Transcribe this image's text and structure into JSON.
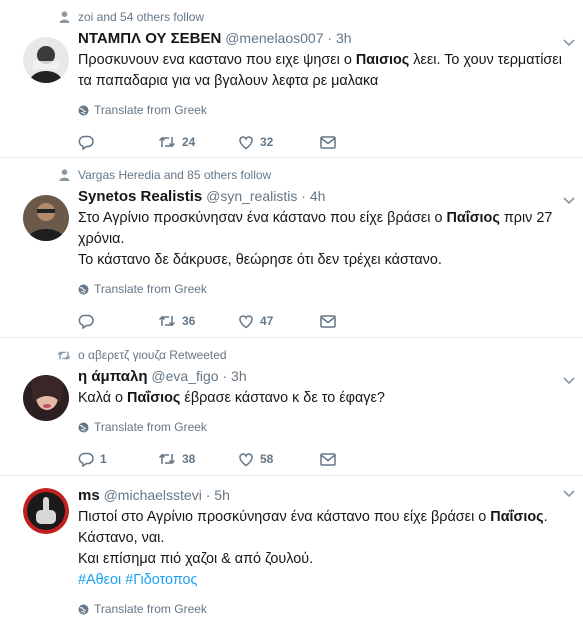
{
  "tweets": [
    {
      "context": "zoi and 54 others follow",
      "context_icon": "person-icon",
      "name": "ΝΤΑΜΠΛ ΟΥ ΣΕΒΕΝ",
      "handle": "@menelaos007",
      "dot": "·",
      "time": "3h",
      "text_parts": [
        "Προσκυνουν ενα καστανο που ειχε ψησει ο ",
        "Παισιος",
        " λεει. Το χουν τερματίσει τα παπαδαρια για να βγαλουν λεφτα ρε μαλακα"
      ],
      "translate": "Translate from Greek",
      "replies": "",
      "retweets": "24",
      "likes": "32"
    },
    {
      "context": "Vargas Heredia and 85 others follow",
      "context_icon": "person-icon",
      "name": "Synetos Realistis",
      "handle": "@syn_realistis",
      "dot": "·",
      "time": "4h",
      "text_parts": [
        "Στο Αγρίνιο προσκύνησαν ένα κάστανο που είχε βράσει ο ",
        "Παΐσιος",
        " πριν 27 χρόνια."
      ],
      "text_line2": "Το κάστανο δε δάκρυσε, θεώρησε ότι δεν τρέχει κάστανο.",
      "translate": "Translate from Greek",
      "replies": "",
      "retweets": "36",
      "likes": "47"
    },
    {
      "context": "ο αβερετζ γιουζα Retweeted",
      "context_icon": "retweet-icon",
      "name": "η άμπαλη",
      "handle": "@eva_figo",
      "dot": "·",
      "time": "3h",
      "text_parts": [
        "Καλά ο ",
        "Παΐσιος",
        " έβρασε κάστανο κ δε το έφαγε?"
      ],
      "translate": "Translate from Greek",
      "replies": "1",
      "retweets": "38",
      "likes": "58"
    },
    {
      "name": "ms",
      "handle": "@michaelsstevi",
      "dot": "·",
      "time": "5h",
      "text_parts": [
        "Πιστοί στο Αγρίνιο προσκύνησαν ένα κάστανο που είχε βράσει ο ",
        "Παΐσιος",
        "."
      ],
      "text_line2": "Κάστανο, ναι.",
      "text_line3": "Και επίσημα πιό χαζοι & από ζουλού.",
      "hashtags": "#Αθεοι #Γιδοτοπος",
      "translate": "Translate from Greek"
    }
  ],
  "colors": {
    "text": "#14171a",
    "muted": "#657786",
    "link": "#1da1f2",
    "border": "#e6ecf0"
  },
  "icons": {
    "caret": "chevron-down-icon",
    "globe": "globe-icon",
    "reply": "reply-icon",
    "retweet": "retweet-icon",
    "like": "heart-icon",
    "message": "envelope-icon"
  }
}
